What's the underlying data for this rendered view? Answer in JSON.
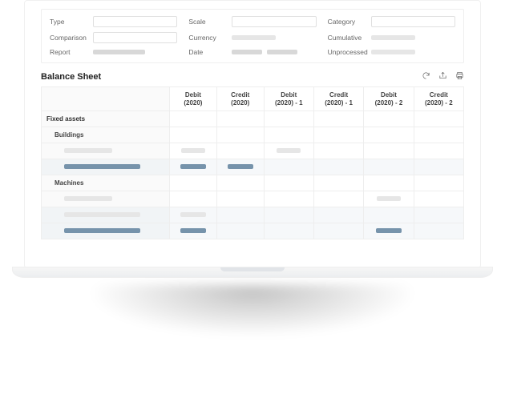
{
  "filters": {
    "row1": {
      "type_label": "Type",
      "scale_label": "Scale",
      "category_label": "Category"
    },
    "row2": {
      "comparison_label": "Comparison",
      "currency_label": "Currency",
      "cumulative_label": "Cumulative"
    },
    "row3": {
      "report_label": "Report",
      "date_label": "Date",
      "unprocessed_label": "Unprocessed"
    }
  },
  "title": "Balance Sheet",
  "columns": {
    "c0": "",
    "c1a": "Debit",
    "c1b": "(2020)",
    "c2a": "Credit",
    "c2b": "(2020)",
    "c3a": "Debit",
    "c3b": "(2020) - 1",
    "c4a": "Credit",
    "c4b": "(2020) - 1",
    "c5a": "Debit",
    "c5b": "(2020) - 2",
    "c6a": "Credit",
    "c6b": "(2020) - 2"
  },
  "sections": {
    "fixed_assets": "Fixed assets",
    "buildings": "Buildings",
    "machines": "Machines"
  },
  "icons": {
    "refresh": "refresh-icon",
    "share": "share-icon",
    "print": "print-icon"
  }
}
